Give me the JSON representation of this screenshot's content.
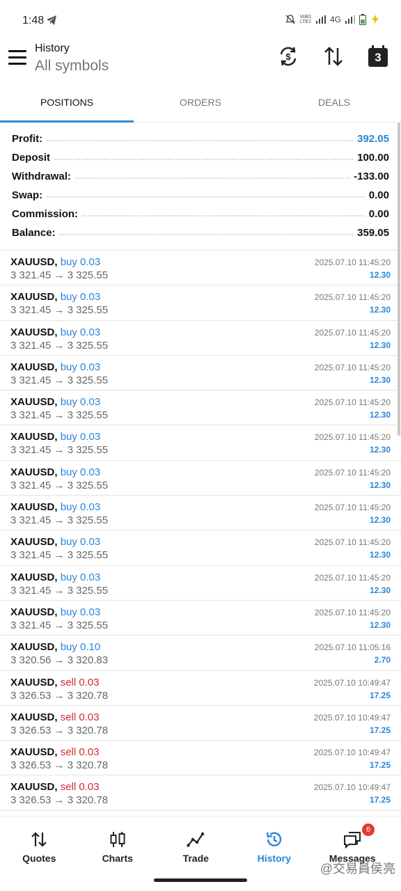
{
  "status": {
    "time": "1:48",
    "network": "4G",
    "volte": "VoB1 LTE2"
  },
  "header": {
    "title": "History",
    "subtitle": "All symbols",
    "calendar_day": "3"
  },
  "tabs": [
    {
      "label": "POSITIONS",
      "active": true
    },
    {
      "label": "ORDERS",
      "active": false
    },
    {
      "label": "DEALS",
      "active": false
    }
  ],
  "summary": [
    {
      "label": "Profit:",
      "value": "392.05",
      "highlight": true
    },
    {
      "label": "Deposit",
      "value": "100.00"
    },
    {
      "label": "Withdrawal:",
      "value": "-133.00"
    },
    {
      "label": "Swap:",
      "value": "0.00"
    },
    {
      "label": "Commission:",
      "value": "0.00"
    },
    {
      "label": "Balance:",
      "value": "359.05"
    }
  ],
  "positions": [
    {
      "symbol": "XAUUSD,",
      "side": "buy",
      "volume": "buy 0.03",
      "prices": "3 321.45 → 3 325.55",
      "time": "2025.07.10 11:45:20",
      "profit": "12.30"
    },
    {
      "symbol": "XAUUSD,",
      "side": "buy",
      "volume": "buy 0.03",
      "prices": "3 321.45 → 3 325.55",
      "time": "2025.07.10 11:45:20",
      "profit": "12.30"
    },
    {
      "symbol": "XAUUSD,",
      "side": "buy",
      "volume": "buy 0.03",
      "prices": "3 321.45 → 3 325.55",
      "time": "2025.07.10 11:45:20",
      "profit": "12.30"
    },
    {
      "symbol": "XAUUSD,",
      "side": "buy",
      "volume": "buy 0.03",
      "prices": "3 321.45 → 3 325.55",
      "time": "2025.07.10 11:45:20",
      "profit": "12.30"
    },
    {
      "symbol": "XAUUSD,",
      "side": "buy",
      "volume": "buy 0.03",
      "prices": "3 321.45 → 3 325.55",
      "time": "2025.07.10 11:45:20",
      "profit": "12.30"
    },
    {
      "symbol": "XAUUSD,",
      "side": "buy",
      "volume": "buy 0.03",
      "prices": "3 321.45 → 3 325.55",
      "time": "2025.07.10 11:45:20",
      "profit": "12.30"
    },
    {
      "symbol": "XAUUSD,",
      "side": "buy",
      "volume": "buy 0.03",
      "prices": "3 321.45 → 3 325.55",
      "time": "2025.07.10 11:45:20",
      "profit": "12.30"
    },
    {
      "symbol": "XAUUSD,",
      "side": "buy",
      "volume": "buy 0.03",
      "prices": "3 321.45 → 3 325.55",
      "time": "2025.07.10 11:45:20",
      "profit": "12.30"
    },
    {
      "symbol": "XAUUSD,",
      "side": "buy",
      "volume": "buy 0.03",
      "prices": "3 321.45 → 3 325.55",
      "time": "2025.07.10 11:45:20",
      "profit": "12.30"
    },
    {
      "symbol": "XAUUSD,",
      "side": "buy",
      "volume": "buy 0.03",
      "prices": "3 321.45 → 3 325.55",
      "time": "2025.07.10 11:45:20",
      "profit": "12.30"
    },
    {
      "symbol": "XAUUSD,",
      "side": "buy",
      "volume": "buy 0.03",
      "prices": "3 321.45 → 3 325.55",
      "time": "2025.07.10 11:45:20",
      "profit": "12.30"
    },
    {
      "symbol": "XAUUSD,",
      "side": "buy",
      "volume": "buy 0.10",
      "prices": "3 320.56 → 3 320.83",
      "time": "2025.07.10 11:05:16",
      "profit": "2.70"
    },
    {
      "symbol": "XAUUSD,",
      "side": "sell",
      "volume": "sell 0.03",
      "prices": "3 326.53 → 3 320.78",
      "time": "2025.07.10 10:49:47",
      "profit": "17.25"
    },
    {
      "symbol": "XAUUSD,",
      "side": "sell",
      "volume": "sell 0.03",
      "prices": "3 326.53 → 3 320.78",
      "time": "2025.07.10 10:49:47",
      "profit": "17.25"
    },
    {
      "symbol": "XAUUSD,",
      "side": "sell",
      "volume": "sell 0.03",
      "prices": "3 326.53 → 3 320.78",
      "time": "2025.07.10 10:49:47",
      "profit": "17.25"
    },
    {
      "symbol": "XAUUSD,",
      "side": "sell",
      "volume": "sell 0.03",
      "prices": "3 326.53 → 3 320.78",
      "time": "2025.07.10 10:49:47",
      "profit": "17.25"
    }
  ],
  "nav": [
    {
      "label": "Quotes",
      "icon": "quotes-icon"
    },
    {
      "label": "Charts",
      "icon": "charts-icon"
    },
    {
      "label": "Trade",
      "icon": "trade-icon"
    },
    {
      "label": "History",
      "icon": "history-icon",
      "active": true
    },
    {
      "label": "Messages",
      "icon": "messages-icon",
      "badge": "6"
    }
  ],
  "watermark": "@交易員侯亮",
  "colors": {
    "accent": "#2a85d6",
    "sell": "#d42a2a",
    "badge": "#e53935"
  }
}
